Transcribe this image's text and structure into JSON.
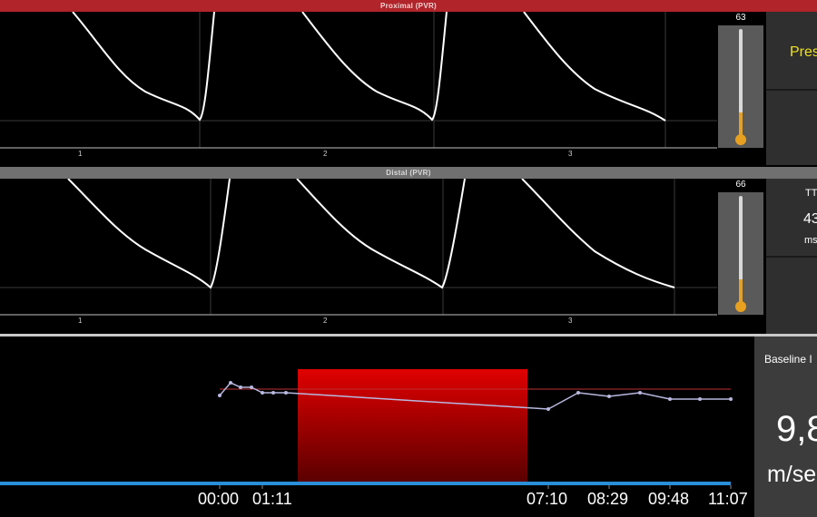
{
  "proximal": {
    "header": "Proximal (PVR)",
    "scale_value": "63",
    "ticks": [
      "1",
      "2",
      "3"
    ],
    "side_label": "Pres"
  },
  "distal": {
    "header": "Distal (PVR)",
    "scale_value": "66",
    "ticks": [
      "1",
      "2",
      "3"
    ],
    "side_title": "TT",
    "side_value": "43",
    "side_unit": "ms"
  },
  "trend": {
    "times": [
      "00:00",
      "01:11",
      "07:10",
      "08:29",
      "09:48",
      "11:07"
    ],
    "panel_title": "Baseline I",
    "panel_value": "9,8",
    "panel_unit": "m/se"
  },
  "colors": {
    "header_red": "#b0242a",
    "header_gray": "#707070",
    "highlight": "#d40000",
    "trace": "#ffffff",
    "trend_line": "#b8b8e0",
    "baseline": "#2a8fd8",
    "label_yellow": "#f0e020"
  }
}
